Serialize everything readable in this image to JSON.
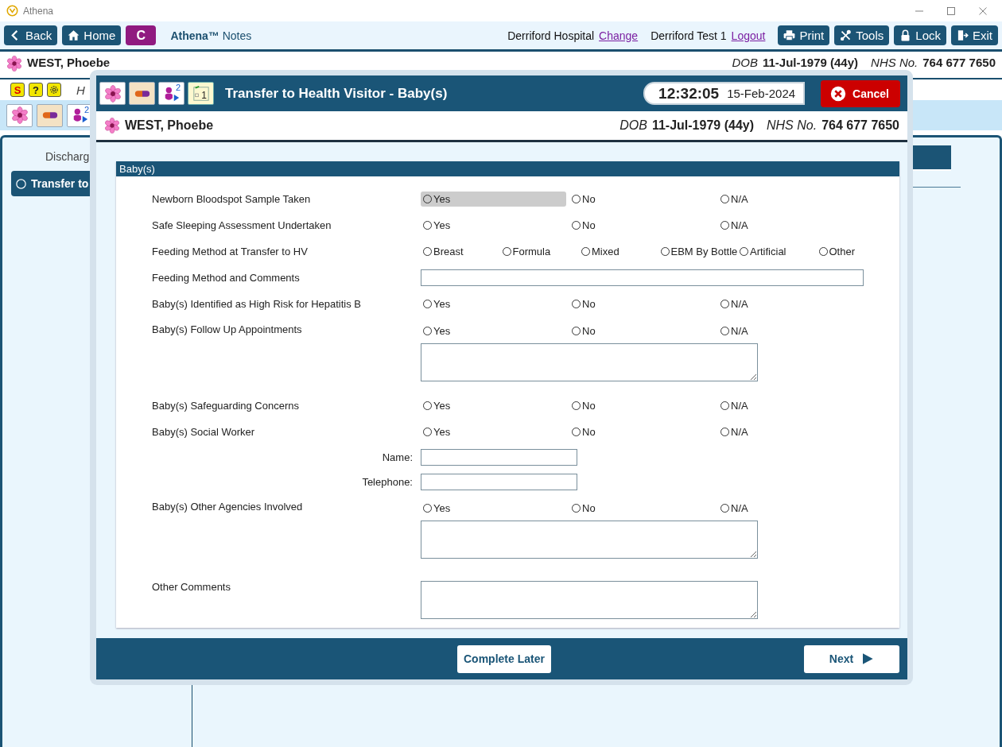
{
  "window": {
    "title": "Athena"
  },
  "toolbar": {
    "nav_buttons": [
      {
        "kind": "back",
        "label": "Back"
      },
      {
        "kind": "home",
        "label": "Home"
      },
      {
        "kind": "module",
        "label": "C"
      }
    ],
    "app_title": "**Athena™** Notes",
    "location": "Derriford Hospital",
    "location_link": "Change",
    "user": "Derriford Test 1",
    "user_link": "Logout",
    "actions": [
      {
        "kind": "print",
        "label": "Print"
      },
      {
        "kind": "tools",
        "label": "Tools"
      },
      {
        "kind": "lock",
        "label": "Lock"
      },
      {
        "kind": "exit",
        "label": "Exit"
      }
    ]
  },
  "patient": {
    "name": "WEST, Phoebe",
    "dob_label": "DOB",
    "dob": "11-Jul-1979 (44y)",
    "nhs_label": "NHS No.",
    "nhs": "764 677 7650"
  },
  "alert_icons": [
    {
      "kind": "alert",
      "label": "S"
    },
    {
      "kind": "help",
      "label": "?"
    },
    {
      "kind": "settings"
    }
  ],
  "alert_text": "H",
  "patient_icons": [
    {
      "kind": "flower"
    },
    {
      "kind": "medication"
    },
    {
      "kind": "mother_baby",
      "badge": "2"
    }
  ],
  "left_panel": {
    "heading": "Discharg",
    "items": [
      {
        "label": "Transfer to",
        "selected": true
      }
    ]
  },
  "dialog": {
    "icons": [
      {
        "kind": "flower"
      },
      {
        "kind": "medication"
      },
      {
        "kind": "mother_baby",
        "badge": "2"
      },
      {
        "kind": "calendar",
        "badge": "1"
      }
    ],
    "title": "Transfer to Health Visitor - Baby(s)",
    "time": "12:32:05",
    "date": "15-Feb-2024",
    "cancel": "Cancel",
    "patient": {
      "name": "WEST, Phoebe",
      "dob_label": "DOB",
      "dob": "11-Jul-1979 (44y)",
      "nhs_label": "NHS No.",
      "nhs": "764 677 7650"
    },
    "section_title": "Baby(s)",
    "fields": [
      {
        "kind": "radio",
        "label": "Newborn Bloodspot Sample Taken",
        "options": [
          {
            "label": "Yes",
            "selected": false,
            "highlighted": true
          },
          {
            "label": "No",
            "selected": false,
            "highlighted": false
          },
          {
            "label": "N/A",
            "selected": false,
            "highlighted": false
          }
        ]
      },
      {
        "kind": "radio",
        "label": "Safe Sleeping Assessment Undertaken",
        "options": [
          {
            "label": "Yes",
            "selected": false,
            "highlighted": false
          },
          {
            "label": "No",
            "selected": false,
            "highlighted": false
          },
          {
            "label": "N/A",
            "selected": false,
            "highlighted": false
          }
        ]
      },
      {
        "kind": "radio",
        "label": "Feeding Method at Transfer to HV",
        "options": [
          {
            "label": "Breast",
            "selected": false,
            "highlighted": false
          },
          {
            "label": "Formula",
            "selected": false,
            "highlighted": false
          },
          {
            "label": "Mixed",
            "selected": false,
            "highlighted": false
          },
          {
            "label": "EBM By Bottle",
            "selected": false,
            "highlighted": false
          },
          {
            "label": "Artificial",
            "selected": false,
            "highlighted": false
          },
          {
            "label": "Other",
            "selected": false,
            "highlighted": false
          }
        ]
      },
      {
        "kind": "input",
        "label": "Feeding Method and Comments"
      },
      {
        "kind": "radio",
        "label": "Baby(s) Identified as High Risk for Hepatitis B",
        "options": [
          {
            "label": "Yes",
            "selected": false,
            "highlighted": false
          },
          {
            "label": "No",
            "selected": false,
            "highlighted": false
          },
          {
            "label": "N/A",
            "selected": false,
            "highlighted": false
          }
        ]
      },
      {
        "kind": "radio_notes",
        "label": "Baby(s) Follow Up Appointments",
        "options": [
          {
            "label": "Yes",
            "selected": false,
            "highlighted": false
          },
          {
            "label": "No",
            "selected": false,
            "highlighted": false
          },
          {
            "label": "N/A",
            "selected": false,
            "highlighted": false
          }
        ]
      },
      {
        "kind": "radio",
        "label": "Baby(s) Safeguarding Concerns",
        "options": [
          {
            "label": "Yes",
            "selected": false,
            "highlighted": false
          },
          {
            "label": "No",
            "selected": false,
            "highlighted": false
          },
          {
            "label": "N/A",
            "selected": false,
            "highlighted": false
          }
        ]
      },
      {
        "kind": "radio",
        "label": "Baby(s) Social Worker",
        "options": [
          {
            "label": "Yes",
            "selected": false,
            "highlighted": false
          },
          {
            "label": "No",
            "selected": false,
            "highlighted": false
          },
          {
            "label": "N/A",
            "selected": false,
            "highlighted": false
          }
        ]
      },
      {
        "kind": "sub_input",
        "label": "Name:"
      },
      {
        "kind": "sub_input",
        "label": "Telephone:"
      },
      {
        "kind": "radio_notes",
        "label": "Baby(s) Other Agencies Involved",
        "options": [
          {
            "label": "Yes",
            "selected": false,
            "highlighted": false
          },
          {
            "label": "No",
            "selected": false,
            "highlighted": false
          },
          {
            "label": "N/A",
            "selected": false,
            "highlighted": false
          }
        ]
      },
      {
        "kind": "textarea",
        "label": "Other Comments"
      }
    ],
    "complete_later": "Complete Later",
    "next": "Next"
  }
}
